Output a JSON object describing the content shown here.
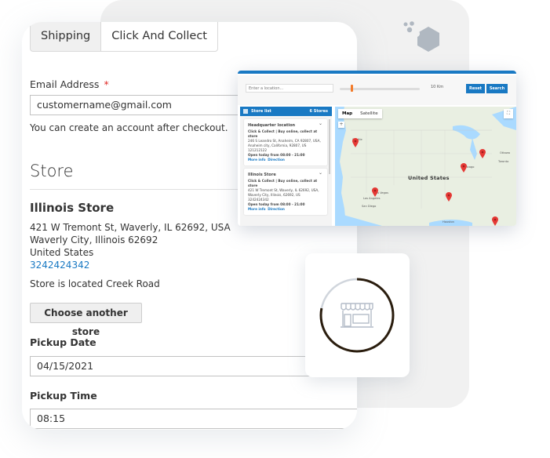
{
  "tabs": [
    {
      "label": "Shipping",
      "active": false
    },
    {
      "label": "Click And Collect",
      "active": true
    }
  ],
  "email": {
    "label": "Email Address",
    "required_mark": "*",
    "value": "customername@gmail.com",
    "note": "You can create an account after checkout."
  },
  "store_section": {
    "title": "Store",
    "store_name": "Illinois Store",
    "address_lines": [
      "421 W Tremont St, Waverly, IL 62692, USA",
      "Waverly City, Illinois 62692",
      "United States"
    ],
    "phone": "3242424342",
    "description": "Store is located Creek Road",
    "choose_button": "Choose another store"
  },
  "pickup": {
    "date_label": "Pickup Date",
    "date_value": "04/15/2021",
    "time_label": "Pickup Time",
    "time_value": "08:15"
  },
  "store_locator": {
    "location_placeholder": "Enter a location...",
    "radius": "10 Km",
    "radius_fraction": 0.13,
    "reset_label": "Reset",
    "search_label": "Search",
    "list_title": "Store list",
    "store_count": "6 Stores",
    "stores": [
      {
        "name": "Headquarter location",
        "service": "Click & Collect | Buy online, collect at store",
        "address": "246 S Leandro St, Anaheim, CA 92807, USA, Anaheim city, California, 92807, US",
        "phone": "121212122",
        "hours": "Open today from 08:00 - 21:00",
        "more_info": "More info",
        "direction": "Direction"
      },
      {
        "name": "Illinois Store",
        "service": "Click & Collect | Buy online, collect at store",
        "address": "421 W Tremont St, Waverly, IL 62692, USA, Waverly City, Illinois, 62692, US",
        "phone": "3242424342",
        "hours": "Open today from 08:00 - 21:00",
        "more_info": "More info",
        "direction": "Direction"
      }
    ],
    "map": {
      "type_map": "Map",
      "type_satellite": "Satellite",
      "zoom_in": "+",
      "fullscreen": "⛶",
      "country_label": "United States",
      "city_labels": [
        "Seattle",
        "Las Vegas",
        "Los Angeles",
        "San Diego",
        "Chicago",
        "Houston",
        "Toronto",
        "Ottawa"
      ]
    }
  },
  "colors": {
    "accent": "#1979c3",
    "slider": "#f37b2a",
    "marker": "#e53935",
    "required": "#e02b27",
    "ring_progress": "#2a1d0e",
    "ring_track": "#d0d5dc"
  },
  "loader": {
    "progress_fraction": 0.78,
    "icon": "storefront-icon"
  }
}
